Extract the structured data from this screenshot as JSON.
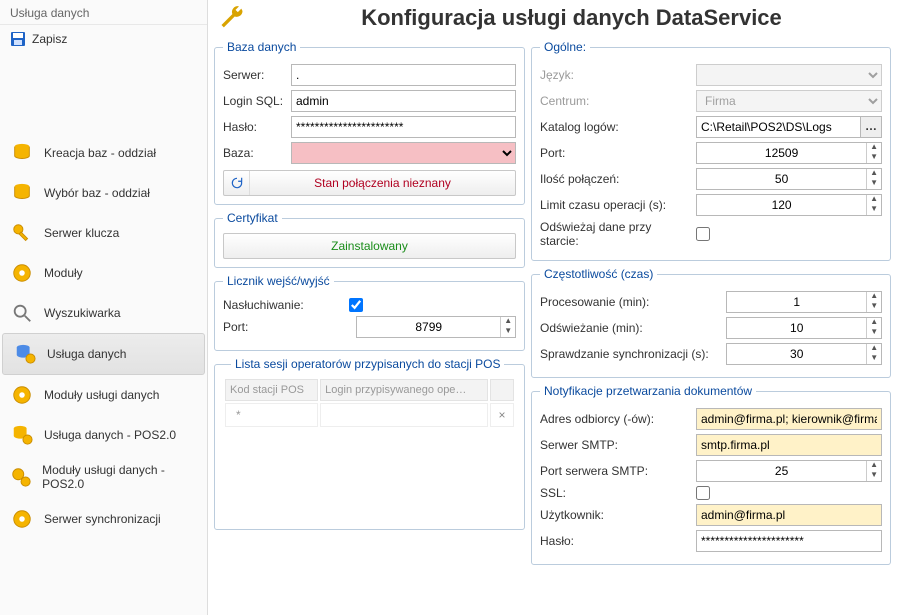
{
  "sidebar": {
    "header": "Usługa danych",
    "save": "Zapisz",
    "items": [
      {
        "label": "Kreacja baz - oddział"
      },
      {
        "label": "Wybór baz - oddział"
      },
      {
        "label": "Serwer klucza"
      },
      {
        "label": "Moduły"
      },
      {
        "label": "Wyszukiwarka"
      },
      {
        "label": "Usługa danych"
      },
      {
        "label": "Moduły usługi danych"
      },
      {
        "label": "Usługa danych - POS2.0"
      },
      {
        "label": "Moduły usługi danych - POS2.0"
      },
      {
        "label": "Serwer synchronizacji"
      }
    ]
  },
  "title": "Konfiguracja usługi danych DataService",
  "db": {
    "legend": "Baza danych",
    "server_label": "Serwer:",
    "server_value": ".",
    "login_label": "Login SQL:",
    "login_value": "admin",
    "password_label": "Hasło:",
    "password_value": "***********************",
    "base_label": "Baza:",
    "base_value": "",
    "conn_status": "Stan połączenia nieznany"
  },
  "cert": {
    "legend": "Certyfikat",
    "status": "Zainstalowany"
  },
  "counter": {
    "legend": "Licznik wejść/wyjść",
    "listen_label": "Nasłuchiwanie:",
    "listen_checked": true,
    "port_label": "Port:",
    "port_value": "8799"
  },
  "sessions": {
    "legend": "Lista sesji operatorów przypisanych do stacji POS",
    "col1": "Kod stacji POS",
    "col2": "Login przypisywanego ope…",
    "star": "*"
  },
  "general": {
    "legend": "Ogólne:",
    "lang_label": "Język:",
    "center_label": "Centrum:",
    "center_value": "Firma",
    "logdir_label": "Katalog logów:",
    "logdir_value": "C:\\Retail\\POS2\\DS\\Logs",
    "port_label": "Port:",
    "port_value": "12509",
    "conn_count_label": "Ilość połączeń:",
    "conn_count_value": "50",
    "op_limit_label": "Limit czasu operacji (s):",
    "op_limit_value": "120",
    "refresh_start_label": "Odświeżaj dane przy starcie:",
    "refresh_start_checked": false
  },
  "freq": {
    "legend": "Częstotliwość (czas)",
    "proc_label": "Procesowanie (min):",
    "proc_value": "1",
    "refresh_label": "Odświeżanie (min):",
    "refresh_value": "10",
    "sync_label": "Sprawdzanie synchronizacji (s):",
    "sync_value": "30"
  },
  "notify": {
    "legend": "Notyfikacje przetwarzania dokumentów",
    "recip_label": "Adres odbiorcy (-ów):",
    "recip_value": "admin@firma.pl; kierownik@firma.pl",
    "smtp_label": "Serwer SMTP:",
    "smtp_value": "smtp.firma.pl",
    "smtp_port_label": "Port serwera SMTP:",
    "smtp_port_value": "25",
    "ssl_label": "SSL:",
    "ssl_checked": false,
    "user_label": "Użytkownik:",
    "user_value": "admin@firma.pl",
    "pass_label": "Hasło:",
    "pass_value": "**********************"
  }
}
